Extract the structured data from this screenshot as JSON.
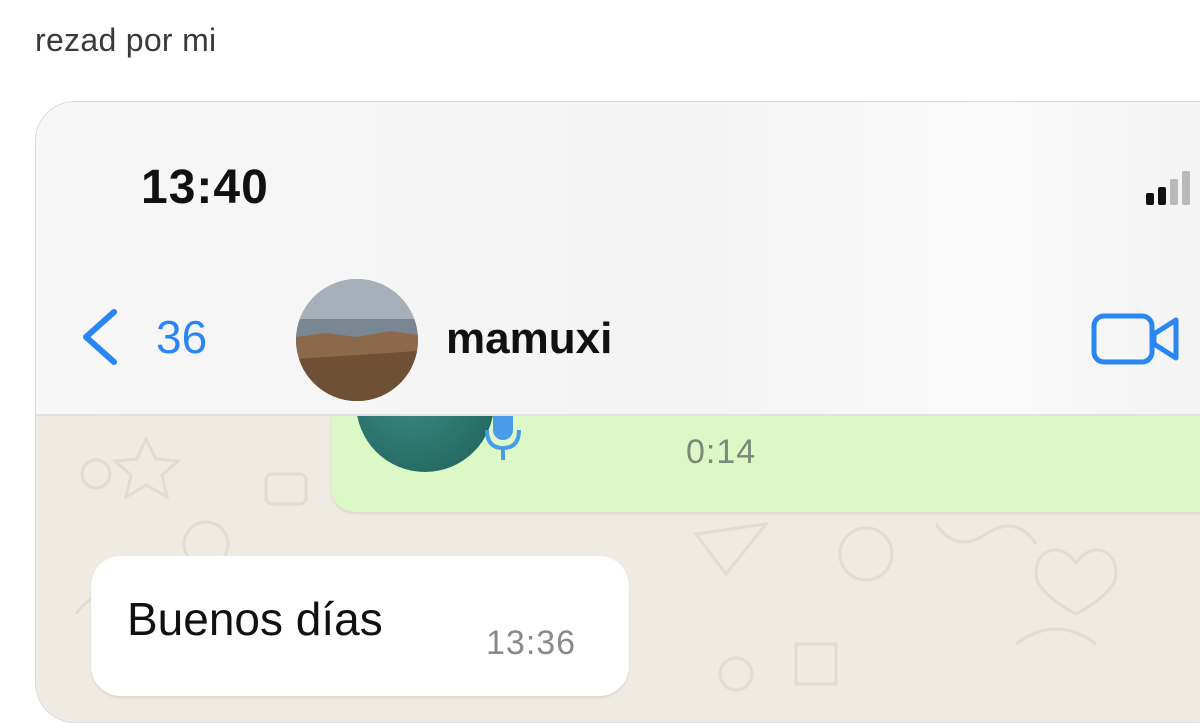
{
  "post": {
    "caption": "rezad por mi"
  },
  "status_bar": {
    "time": "13:40",
    "signal_icon": "signal-bars-icon"
  },
  "header": {
    "back_icon": "chevron-left-icon",
    "unread_count": "36",
    "contact_name": "mamuxi",
    "video_call_icon": "video-camera-icon",
    "accent_color": "#2a86f2"
  },
  "messages": [
    {
      "type": "voice",
      "direction": "outgoing",
      "duration": "0:14",
      "icon": "microphone-icon"
    },
    {
      "type": "text",
      "direction": "incoming",
      "text": "Buenos días",
      "time": "13:36"
    }
  ],
  "colors": {
    "outgoing_bubble": "#dcf8c6",
    "incoming_bubble": "#ffffff",
    "chat_background": "#efeae2"
  }
}
